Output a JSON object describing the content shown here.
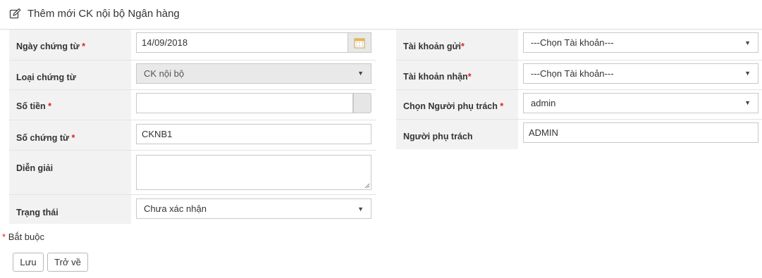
{
  "header": {
    "title": "Thêm mới CK nội bộ Ngân hàng",
    "icon": "edit-icon"
  },
  "left_form": {
    "ngay_chung_tu": {
      "label": "Ngày chứng từ",
      "value": "14/09/2018"
    },
    "loai_chung_tu": {
      "label": "Loại chứng từ",
      "value": "CK nội bộ"
    },
    "so_tien": {
      "label": "Số tiền",
      "value": ""
    },
    "so_chung_tu": {
      "label": "Số chứng từ",
      "value": "CKNB1"
    },
    "dien_giai": {
      "label": "Diễn giải",
      "value": ""
    },
    "trang_thai": {
      "label": "Trạng thái",
      "value": "Chưa xác nhận"
    }
  },
  "right_form": {
    "tai_khoan_gui": {
      "label": "Tài khoản gửi",
      "value": "---Chọn Tài khoản---"
    },
    "tai_khoan_nhan": {
      "label": "Tài khoản nhận",
      "value": "---Chọn Tài khoản---"
    },
    "chon_nguoi_phu_trach": {
      "label": "Chọn Người phụ trách",
      "value": "admin"
    },
    "nguoi_phu_trach": {
      "label": "Người phụ trách",
      "value": "ADMIN"
    }
  },
  "required_marker": "*",
  "required_note": "Bắt buộc",
  "buttons": {
    "save": "Lưu",
    "back": "Trở về"
  },
  "colors": {
    "required": "#e02020",
    "label_bg": "#f2f2f2",
    "border": "#c8c8c8"
  }
}
